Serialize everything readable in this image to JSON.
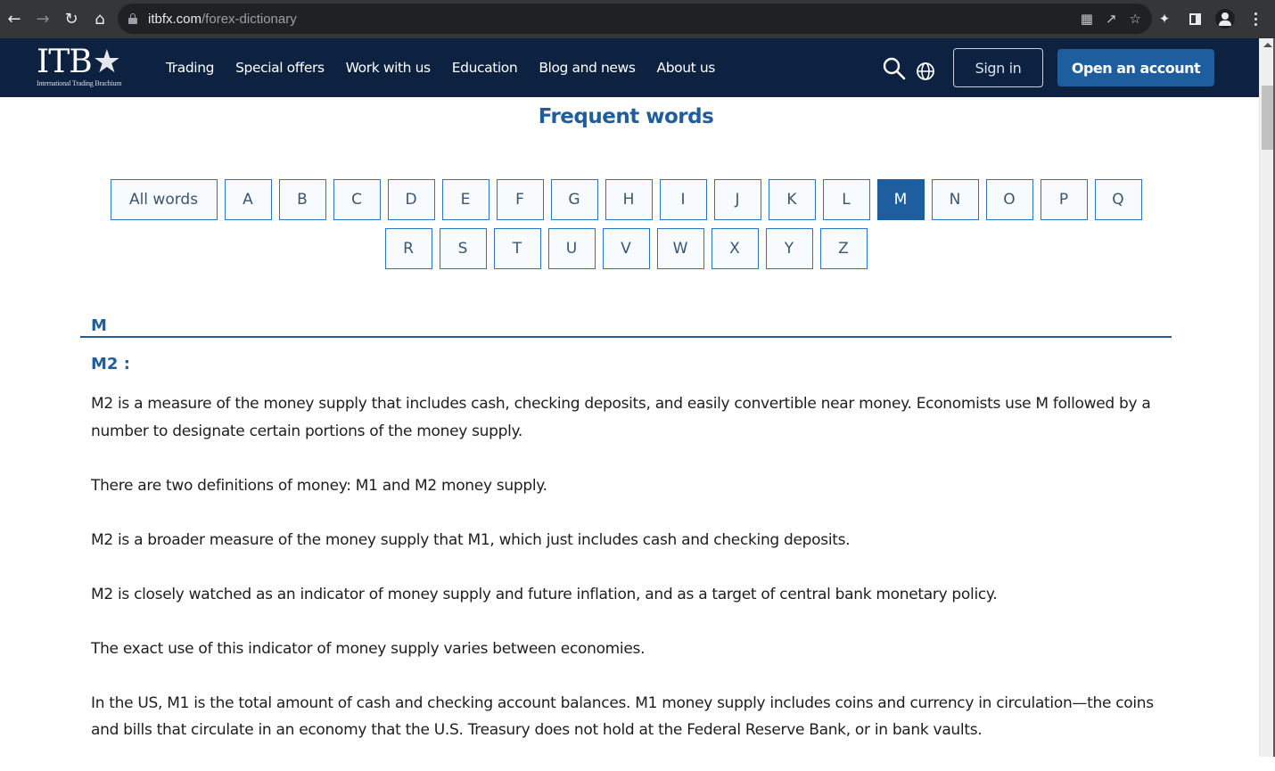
{
  "browser": {
    "url_domain": "itbfx.com",
    "url_path": "/forex-dictionary",
    "icons": [
      "back-icon",
      "forward-icon",
      "reload-icon",
      "home-icon",
      "lock-icon",
      "translate-icon",
      "share-icon",
      "bookmark-star-icon",
      "extensions-puzzle-icon",
      "side-panel-icon",
      "profile-icon",
      "menu-kebab-icon"
    ]
  },
  "header": {
    "logo_text": "ITB",
    "logo_tagline": "International Trading Brachium",
    "nav": [
      "Trading",
      "Special offers",
      "Work with us",
      "Education",
      "Blog and news",
      "About us"
    ],
    "sign_in": "Sign in",
    "open_account": "Open an account"
  },
  "main": {
    "title": "Frequent words",
    "letters_row1": [
      "All words",
      "A",
      "B",
      "C",
      "D",
      "E",
      "F",
      "G",
      "H",
      "I",
      "J",
      "K",
      "L",
      "M",
      "N",
      "O",
      "P",
      "Q"
    ],
    "letters_row2": [
      "R",
      "S",
      "T",
      "U",
      "V",
      "W",
      "X",
      "Y",
      "Z"
    ],
    "active_letter": "M",
    "section_letter": "M",
    "term": "M2 :",
    "paragraphs": [
      "M2 is a measure of the money supply that includes cash, checking deposits, and easily convertible near money. Economists use M followed by a number to designate certain portions of the money supply.",
      "There are two definitions of money: M1 and M2 money supply.",
      "M2 is a broader measure of the money supply that M1, which just includes cash and checking deposits.",
      "M2 is closely watched as an indicator of money supply and future inflation, and as a target of central bank monetary policy.",
      "The exact use of this indicator of money supply varies between economies.",
      "In the US, M1 is the total amount of cash and checking account balances. M1 money supply includes coins and currency in circulation—the coins and bills that circulate in an economy that the U.S. Treasury does not hold at the Federal Reserve Bank, or in bank vaults."
    ]
  },
  "colors": {
    "header_bg": "#0c2240",
    "accent": "#1f5e9e",
    "letter_border": "#2b73c6"
  }
}
